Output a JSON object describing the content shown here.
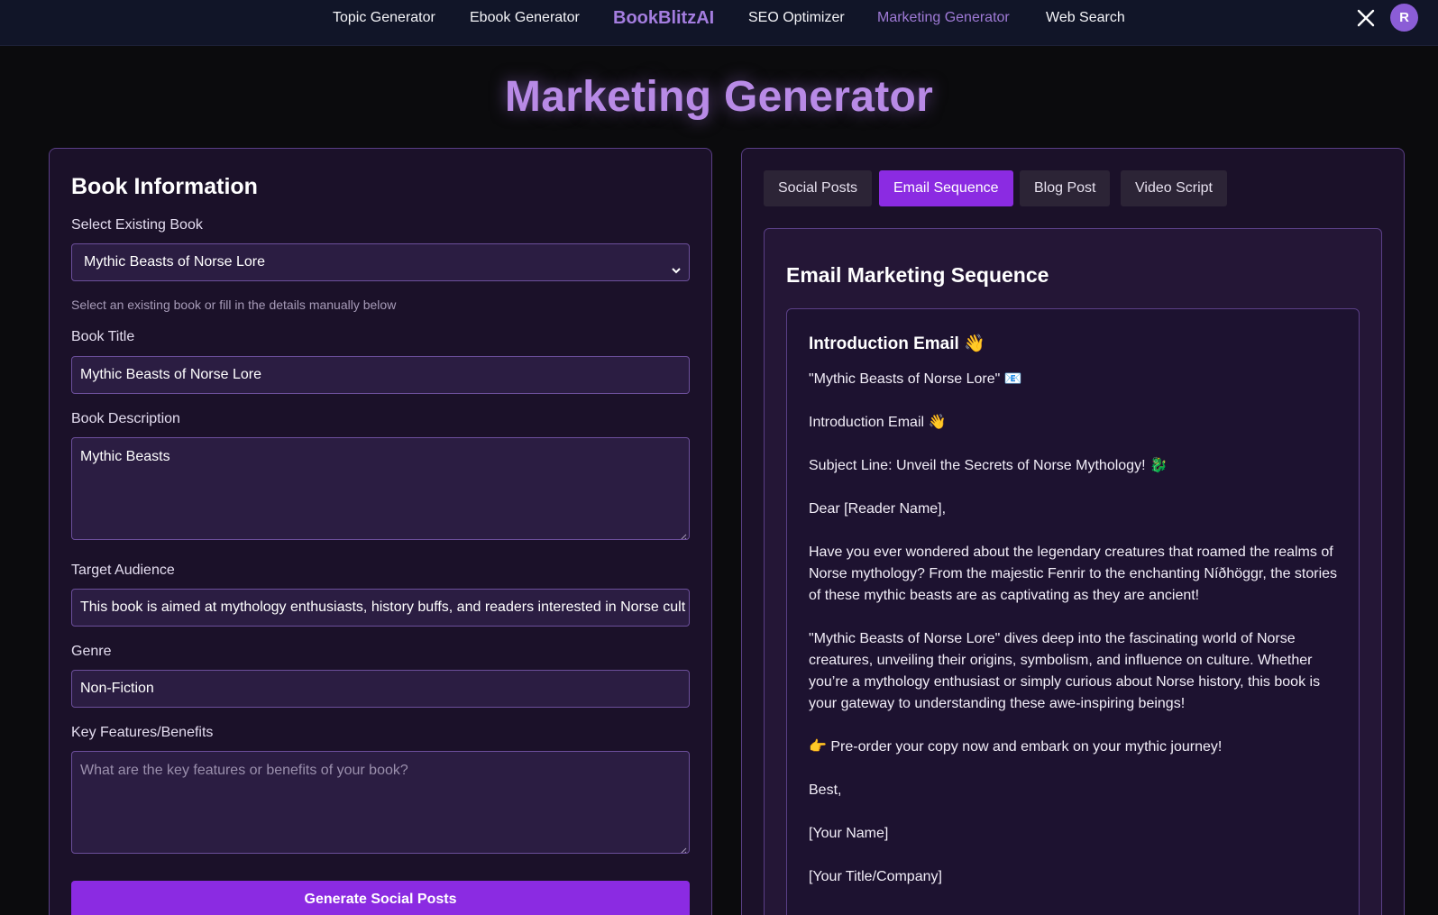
{
  "nav": {
    "links": [
      {
        "label": "Topic Generator"
      },
      {
        "label": "Ebook Generator"
      },
      {
        "label": "SEO Optimizer"
      },
      {
        "label": "Marketing Generator"
      },
      {
        "label": "Web Search"
      }
    ],
    "brand": "BookBlitzAI",
    "x_icon": "x-logo-icon",
    "avatar_initial": "R",
    "active_color": "#9f7ad6"
  },
  "page": {
    "title": "Marketing Generator"
  },
  "book_form": {
    "section_title": "Book Information",
    "select_label": "Select Existing Book",
    "select_value": "Mythic Beasts of Norse Lore",
    "select_hint": "Select an existing book or fill in the details manually below",
    "title_label": "Book Title",
    "title_value": "Mythic Beasts of Norse Lore",
    "description_label": "Book Description",
    "description_value": "Mythic Beasts",
    "audience_label": "Target Audience",
    "audience_value": "This book is aimed at mythology enthusiasts, history buffs, and readers interested in Norse cult",
    "genre_label": "Genre",
    "genre_value": "Non-Fiction",
    "features_label": "Key Features/Benefits",
    "features_placeholder": "What are the key features or benefits of your book?",
    "generate_button": "Generate Social Posts",
    "accent_color": "#8b2be2"
  },
  "tabs": [
    {
      "label": "Social Posts",
      "active": false
    },
    {
      "label": "Email Sequence",
      "active": true
    },
    {
      "label": "Blog Post",
      "active": false
    },
    {
      "label": "Video Script",
      "active": false
    }
  ],
  "email": {
    "section_title": "Email Marketing Sequence",
    "heading": "Introduction Email 👋",
    "lines": [
      "\"Mythic Beasts of Norse Lore\" 📧",
      "Introduction Email 👋",
      "Subject Line: Unveil the Secrets of Norse Mythology! 🐉",
      "Dear [Reader Name],",
      "Have you ever wondered about the legendary creatures that roamed the realms of Norse mythology? From the majestic Fenrir to the enchanting Níðhöggr, the stories of these mythic beasts are as captivating as they are ancient!",
      "\"Mythic Beasts of Norse Lore\" dives deep into the fascinating world of Norse creatures, unveiling their origins, symbolism, and influence on culture. Whether you’re a mythology enthusiast or simply curious about Norse history, this book is your gateway to understanding these awe-inspiring beings!",
      "👉 Pre-order your copy now and embark on your mythic journey!",
      "Best,",
      "[Your Name]",
      "[Your Title/Company]"
    ]
  }
}
